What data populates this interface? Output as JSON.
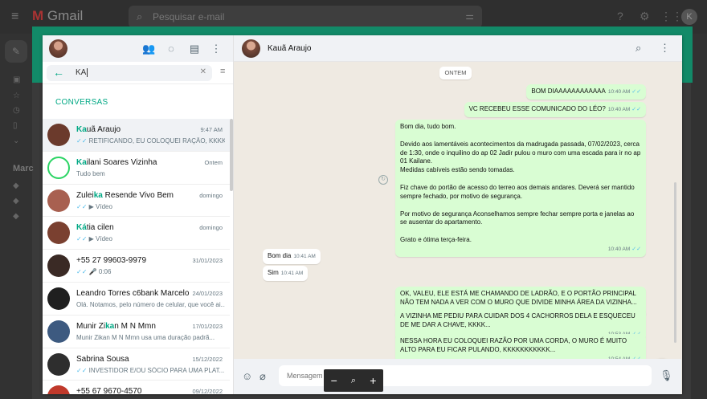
{
  "gmail": {
    "brand": "Gmail",
    "search_placeholder": "Pesquisar e-mail",
    "avatar_letter": "K",
    "side_label": "Marc"
  },
  "sidebar": {
    "search_value": "KA",
    "section_label": "CONVERSAS",
    "conversations": [
      {
        "name_match": "Ka",
        "name_rest": "uã Araujo",
        "time": "9:47 AM",
        "ticks": "✓✓",
        "media": "",
        "preview": "RETIFICANDO, EU COLOQUEI RAÇÃO, KKKK",
        "avatar": "#6b3a2c"
      },
      {
        "name_match": "Ka",
        "name_rest": "ilani Soares Vizinha",
        "time": "Ontem",
        "ticks": "",
        "media": "",
        "preview": "Tudo bem",
        "avatar": "#ffffff"
      },
      {
        "name_pre": "Zulei",
        "name_match": "ka",
        "name_rest": " Resende Vivo Bem",
        "time": "domingo",
        "ticks": "✓✓",
        "media": "▶",
        "preview": "Vídeo",
        "avatar": "#a86050"
      },
      {
        "name_match": "Ká",
        "name_rest": "tia cilen",
        "time": "domingo",
        "ticks": "✓✓",
        "media": "▶",
        "preview": "Vídeo",
        "avatar": "#7a4030"
      },
      {
        "name_match": "",
        "name_rest": "+55 27 99603-9979",
        "time": "31/01/2023",
        "ticks": "✓✓",
        "media": "🎤",
        "preview": "0:06",
        "avatar": "#3a2a25"
      },
      {
        "name_match": "",
        "name_rest": "Leandro Torres c6bank Marcelo ...",
        "time": "24/01/2023",
        "ticks": "",
        "media": "",
        "preview": "Olá. Notamos, pelo número de celular, que você ai...",
        "avatar": "#1f1f1f"
      },
      {
        "name_pre": "Munir Zi",
        "name_match": "ka",
        "name_rest": "n M N Mmn",
        "time": "17/01/2023",
        "ticks": "",
        "media": "",
        "preview": "Munir Zikan M N Mmn usa uma duração padrã...",
        "avatar": "#3d5a80"
      },
      {
        "name_match": "",
        "name_rest": "Sabrina Sousa",
        "time": "15/12/2022",
        "ticks": "✓✓",
        "media": "",
        "preview": "INVESTIDOR E/OU SÓCIO PARA UMA PLAT...",
        "avatar": "#2e2e2e"
      },
      {
        "name_match": "",
        "name_rest": "+55 67 9670-4570",
        "time": "09/12/2022",
        "ticks": "",
        "media": "",
        "preview": "",
        "avatar": "#c0392b"
      }
    ]
  },
  "chat": {
    "contact_name": "Kauã Araujo",
    "day_chip": "ONTEM",
    "messages": [
      {
        "dir": "out",
        "text": "BOM DIAAAAAAAAAAAA",
        "time": "10:40 AM"
      },
      {
        "dir": "out",
        "text": "VC RECEBEU ESSE COMUNICADO DO LÉO?",
        "time": "10:40 AM"
      },
      {
        "dir": "out",
        "paragraphs": [
          "Bom dia, tudo bom.",
          "Devido aos lamentáveis acontecimentos da madrugada passada, 07/02/2023, cerca de 1:30, onde o inquilino do ap 02 Jadir  pulou o muro com uma escada para ir no ap 01 Kailane.",
          "Medidas cabíveis estão sendo tomadas.",
          "Fiz chave do portão de acesso do terreo aos demais andares. Deverá ser mantido sempre fechado, por motivo de segurança.",
          "Por motivo de segurança Aconselhamos sempre fechar sempre porta e janelas ao se ausentar do apartamento.",
          "Grato e ótima terça-feira."
        ],
        "time": "10:40 AM"
      },
      {
        "dir": "in",
        "text": "Bom dia",
        "time": "10:41 AM"
      },
      {
        "dir": "in",
        "text": "Sim",
        "time": "10:41 AM"
      },
      {
        "dir": "out",
        "text": "OK, VALEU, ELE ESTÁ ME CHAMANDO DE LADRÃO, E O PORTÃO PRINCIPAL NÃO TEM NADA A VER COM O MURO QUE DIVIDE MINHA ÁREA DA VIZINHA...",
        "time": "10:43 AM"
      },
      {
        "dir": "out",
        "text": "A VIZINHA ME PEDIU PARA CUIDAR DOS 4 CACHORROS DELA E ESQUECEU DE ME DAR A CHAVE, KKKK...",
        "time": "10:53 AM"
      },
      {
        "dir": "out",
        "text": "NESSA HORA EU COLOQUEI RAZÃO POR UMA CORDA, O MURO É MUITO ALTO PARA EU FICAR PULANDO, KKKKKKKKKKK...",
        "time": "10:54 AM"
      }
    ],
    "input_placeholder": "Mensagem"
  },
  "icons": {
    "menu": "≡",
    "search": "🔍",
    "back": "←",
    "clear": "✕",
    "filter": "≡",
    "communities": "👥",
    "status": "◌",
    "new_chat": "▤",
    "more": "⋮",
    "emoji": "☺",
    "attach": "📎",
    "mic": "🎤",
    "scroll_down": "⌄",
    "zoom_out": "−",
    "zoom": "🔍",
    "zoom_in": "+"
  },
  "colors": {
    "accent": "#00a884",
    "outgoing": "#d9fdd3",
    "read_ticks": "#53bdeb",
    "top_strip": "#128a68"
  }
}
